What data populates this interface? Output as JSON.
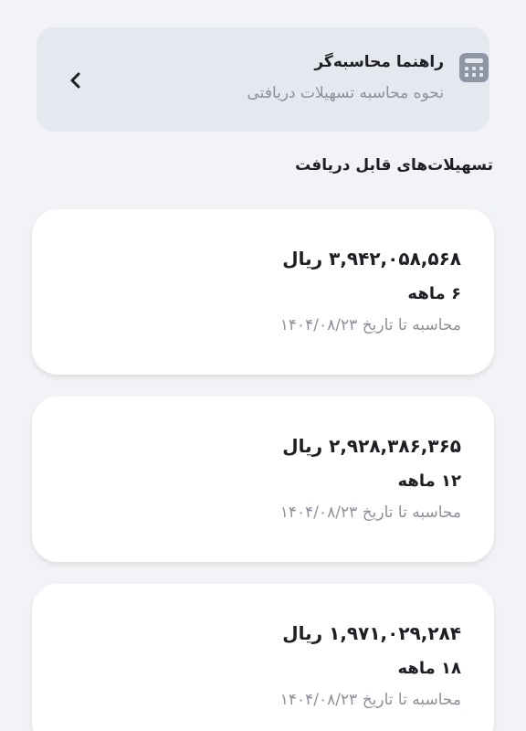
{
  "guide": {
    "title": "راهنما محاسبه‌گر",
    "subtitle": "نحوه محاسبه تسهیلات دریافتی",
    "icon": "calculator-icon",
    "action_icon": "chevron-left-icon"
  },
  "section": {
    "title": "تسهیلات‌های قابل دریافت"
  },
  "facilities": [
    {
      "amount": "۳,۹۴۲,۰۵۸,۵۶۸ ریال",
      "term": "۶ ماهه",
      "date": "محاسبه تا تاریخ ۱۴۰۴/۰۸/۲۳"
    },
    {
      "amount": "۲,۹۲۸,۳۸۶,۳۶۵ ریال",
      "term": "۱۲ ماهه",
      "date": "محاسبه تا تاریخ ۱۴۰۴/۰۸/۲۳"
    },
    {
      "amount": "۱,۹۷۱,۰۲۹,۲۸۴ ریال",
      "term": "۱۸ ماهه",
      "date": "محاسبه تا تاریخ ۱۴۰۴/۰۸/۲۳"
    }
  ]
}
